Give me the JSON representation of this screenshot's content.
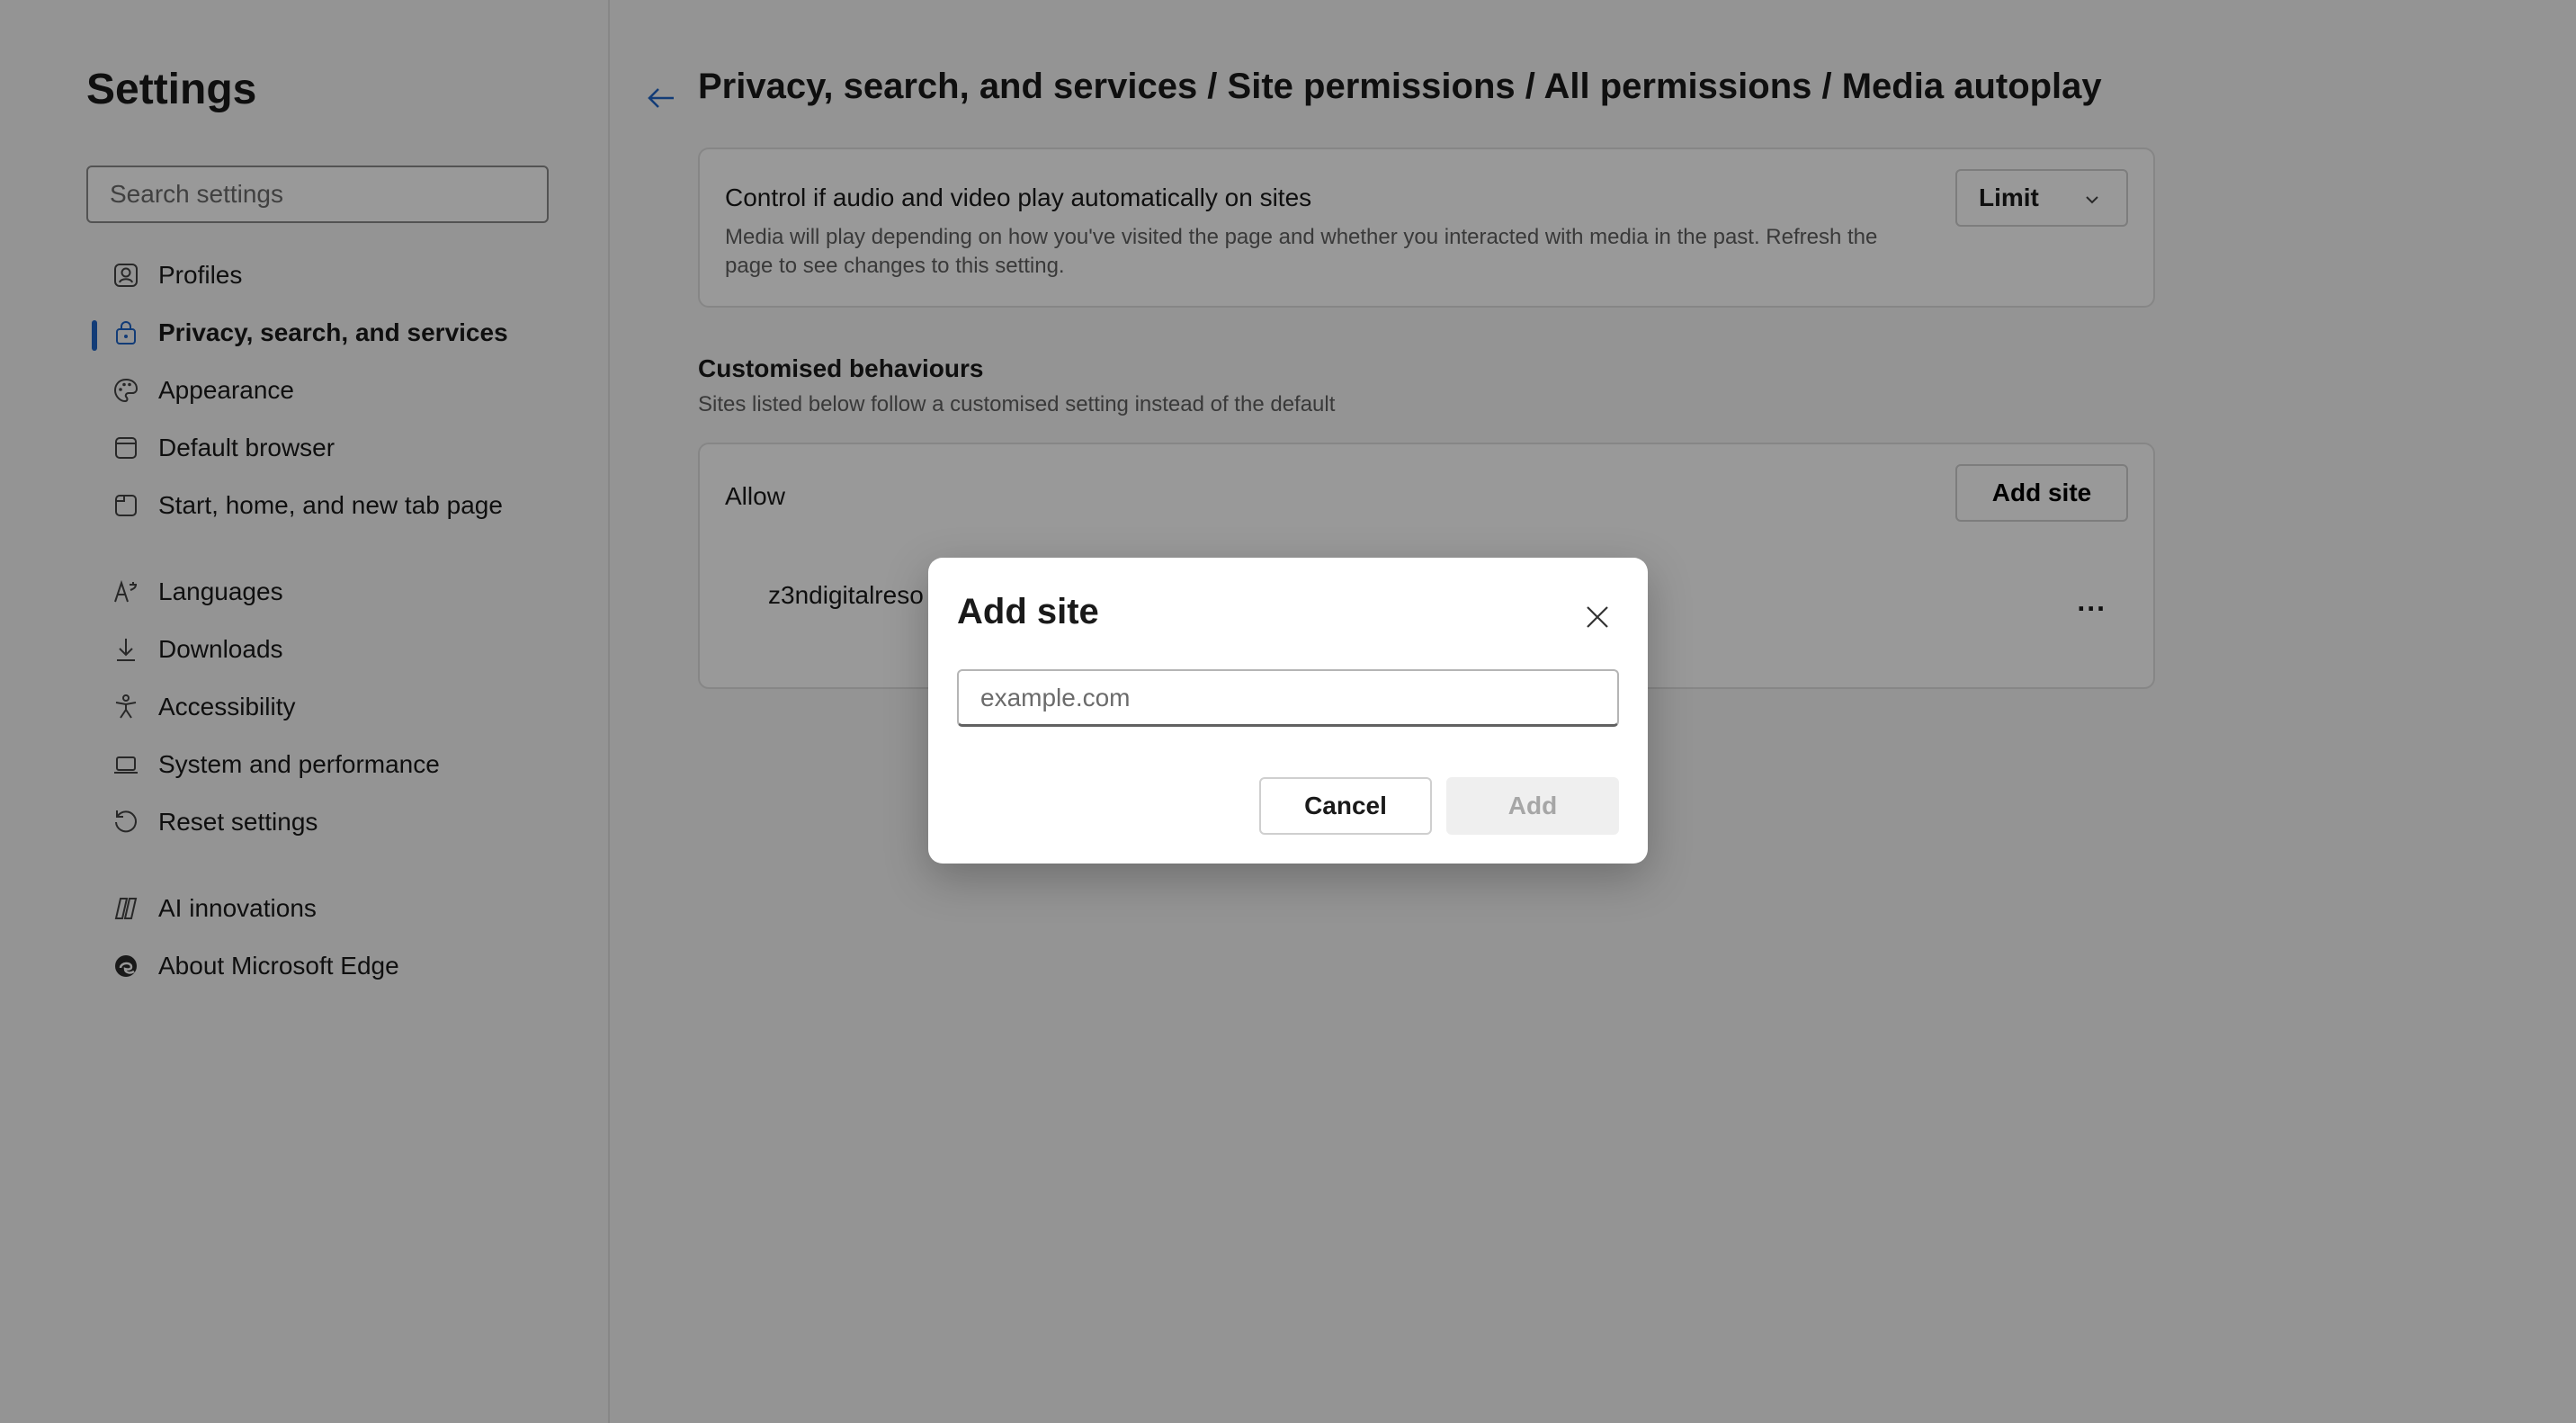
{
  "sidebar": {
    "title": "Settings",
    "search_placeholder": "Search settings",
    "items": [
      {
        "label": "Profiles",
        "icon": "profile-icon"
      },
      {
        "label": "Privacy, search, and services",
        "icon": "lock-icon",
        "active": true
      },
      {
        "label": "Appearance",
        "icon": "palette-icon"
      },
      {
        "label": "Default browser",
        "icon": "browser-icon"
      },
      {
        "label": "Start, home, and new tab page",
        "icon": "home-tab-icon"
      },
      {
        "label": "Languages",
        "icon": "languages-icon"
      },
      {
        "label": "Downloads",
        "icon": "download-icon"
      },
      {
        "label": "Accessibility",
        "icon": "accessibility-icon"
      },
      {
        "label": "System and performance",
        "icon": "laptop-icon"
      },
      {
        "label": "Reset settings",
        "icon": "reset-icon"
      },
      {
        "label": "AI innovations",
        "icon": "copilot-icon"
      },
      {
        "label": "About Microsoft Edge",
        "icon": "edge-icon"
      }
    ]
  },
  "header": {
    "breadcrumb": "Privacy, search, and services / Site permissions / All permissions / Media autoplay"
  },
  "autoplay": {
    "title": "Control if audio and video play automatically on sites",
    "description": "Media will play depending on how you've visited the page and whether you interacted with media in the past. Refresh the page to see changes to this setting.",
    "selected": "Limit"
  },
  "custom": {
    "title": "Customised behaviours",
    "description": "Sites listed below follow a customised setting instead of the default",
    "allow_label": "Allow",
    "add_site_label": "Add site",
    "site": "z3ndigitalreso",
    "more": "..."
  },
  "dialog": {
    "title": "Add site",
    "placeholder": "example.com",
    "cancel": "Cancel",
    "add": "Add"
  },
  "colors": {
    "accent": "#1f64c7",
    "overlay": "rgba(0,0,0,0.4)"
  }
}
